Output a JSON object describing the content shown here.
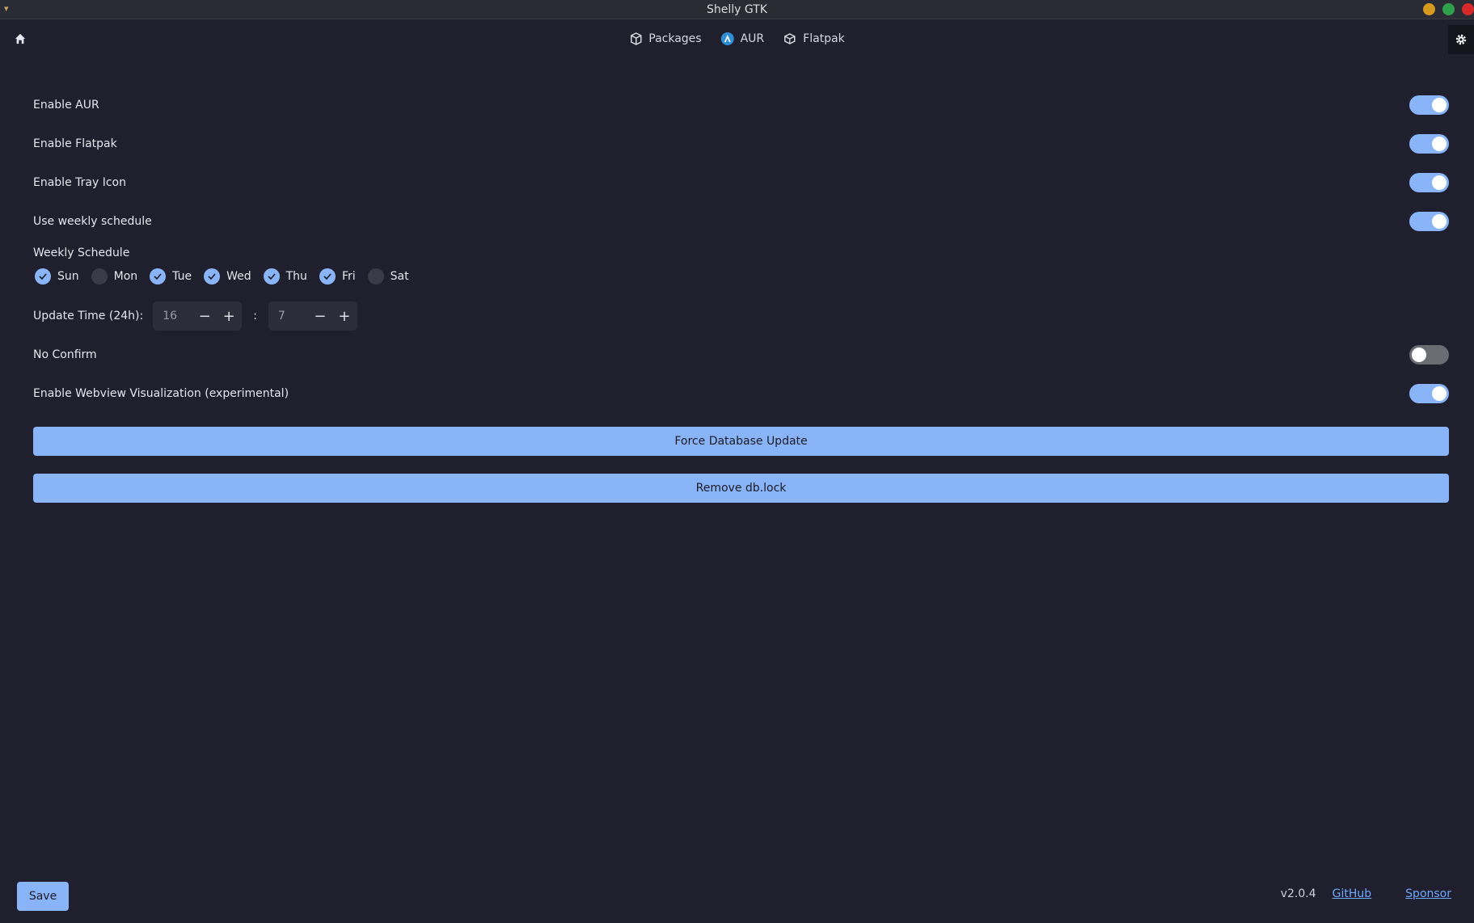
{
  "window": {
    "title": "Shelly GTK",
    "controls": [
      {
        "name": "minimize",
        "color": "#d69a1e"
      },
      {
        "name": "maximize",
        "color": "#2fa14a"
      },
      {
        "name": "close",
        "color": "#d62a2a"
      }
    ]
  },
  "nav": {
    "tabs": [
      {
        "label": "Packages",
        "icon": "package-icon"
      },
      {
        "label": "AUR",
        "icon": "aur-icon"
      },
      {
        "label": "Flatpak",
        "icon": "flatpak-icon"
      }
    ]
  },
  "settings": {
    "enable_aur": {
      "label": "Enable AUR",
      "on": true
    },
    "enable_flatpak": {
      "label": "Enable Flatpak",
      "on": true
    },
    "enable_tray": {
      "label": "Enable Tray Icon",
      "on": true
    },
    "weekly": {
      "label": "Use weekly schedule",
      "on": true
    },
    "schedule_label": "Weekly Schedule",
    "days": [
      {
        "label": "Sun",
        "checked": true
      },
      {
        "label": "Mon",
        "checked": false
      },
      {
        "label": "Tue",
        "checked": true
      },
      {
        "label": "Wed",
        "checked": true
      },
      {
        "label": "Thu",
        "checked": true
      },
      {
        "label": "Fri",
        "checked": true
      },
      {
        "label": "Sat",
        "checked": false
      }
    ],
    "time_label": "Update Time (24h):",
    "hour": "16",
    "minute": "7",
    "colon": ":",
    "no_confirm": {
      "label": "No Confirm",
      "on": false
    },
    "webview": {
      "label": "Enable Webview Visualization (experimental)",
      "on": true
    }
  },
  "actions": {
    "force_update": "Force Database Update",
    "remove_lock": "Remove db.lock"
  },
  "footer": {
    "save": "Save",
    "version": "v2.0.4",
    "github": "GitHub",
    "sponsor": "Sponsor"
  },
  "colors": {
    "background": "#1f1f2e",
    "accent": "#8ab4f8",
    "link": "#6ea8ff"
  }
}
